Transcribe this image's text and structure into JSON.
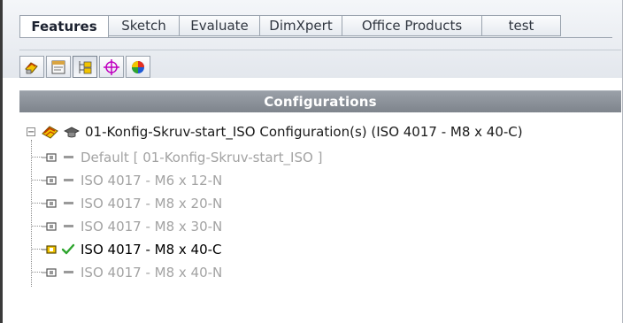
{
  "tabs": [
    {
      "label": "Features",
      "active": true
    },
    {
      "label": "Sketch",
      "active": false
    },
    {
      "label": "Evaluate",
      "active": false
    },
    {
      "label": "DimXpert",
      "active": false
    },
    {
      "label": "Office Products",
      "active": false
    },
    {
      "label": "test",
      "active": false
    }
  ],
  "manager_buttons": [
    {
      "icon": "feature-manager-icon"
    },
    {
      "icon": "property-manager-icon"
    },
    {
      "icon": "configuration-manager-icon",
      "active": true
    },
    {
      "icon": "dimxpert-manager-icon"
    },
    {
      "icon": "display-manager-icon"
    }
  ],
  "panel": {
    "title": "Configurations"
  },
  "tree": {
    "expander": "−",
    "root": {
      "label": "01-Konfig-Skruv-start_ISO Configuration(s)  (ISO 4017 - M8 x 40-C)"
    },
    "configs": [
      {
        "label": "Default [ 01-Konfig-Skruv-start_ISO ]",
        "active": false
      },
      {
        "label": "ISO 4017 - M6 x 12-N",
        "active": false
      },
      {
        "label": "ISO 4017 - M8 x 20-N",
        "active": false
      },
      {
        "label": "ISO 4017 - M8 x 30-N",
        "active": false
      },
      {
        "label": "ISO 4017 - M8 x 40-C",
        "active": true
      },
      {
        "label": "ISO 4017 - M8 x 40-N",
        "active": false
      }
    ]
  },
  "colors": {
    "header_bg": "#8a9098",
    "active_check": "#2ea52e",
    "inactive_text": "#a3a3a3",
    "active_text": "#000000"
  }
}
